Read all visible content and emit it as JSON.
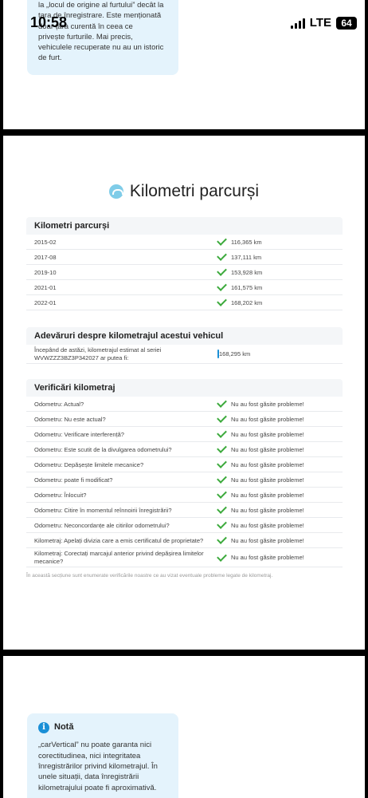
{
  "status_bar": {
    "time": "10:58",
    "network": "LTE",
    "battery": "64"
  },
  "top_info": {
    "lines": [
      "la „locul de origine al furtului” decât la",
      "țara de înregistrare. Este menționată",
      "doar țara curentă în ceea ce",
      "privește furturile. Mai precis,",
      "vehiculele recuperate nu au un istoric",
      "de furt."
    ]
  },
  "section": {
    "title": "Kilometri parcurși"
  },
  "mileage": {
    "heading": "Kilometri parcurși",
    "rows": [
      {
        "date": "2015-02",
        "km": "116,365 km"
      },
      {
        "date": "2017-08",
        "km": "137,111 km"
      },
      {
        "date": "2019-10",
        "km": "153,928 km"
      },
      {
        "date": "2021-01",
        "km": "161,575 km"
      },
      {
        "date": "2022-01",
        "km": "168,202 km"
      }
    ]
  },
  "truths": {
    "heading": "Adevăruri despre kilometrajul acestui vehicul",
    "text_line1": "Începând de astăzi, kilometrajul estimat al seriei",
    "text_line2": "WVWZZZ3BZ3P342027 ar putea fi:",
    "value": "168,295 km"
  },
  "checks": {
    "heading": "Verificări kilometraj",
    "result": "Nu au fost găsite probleme!",
    "rows": [
      "Odometru: Actual?",
      "Odometru: Nu este actual?",
      "Odometru: Verificare interferență?",
      "Odometru: Este scutit de la divulgarea odometrului?",
      "Odometru: Depășește limitele mecanice?",
      "Odometru: poate fi modificat?",
      "Odometru: Înlocuit?",
      "Odometru: Citire în momentul reînnoirii înregistrării?",
      "Odometru: Neconcordanțe ale citirilor odometrului?",
      "Kilometraj: Apelați divizia care a emis certificatul de proprietate?"
    ],
    "last_row_line1": "Kilometraj: Corectați marcajul anterior privind depășirea limitelor",
    "last_row_line2": "mecanice?"
  },
  "footnote": "În această secțiune sunt enumerate verificările noastre ce au vizat eventuale probleme legate de kilometraj.",
  "note": {
    "title": "Notă",
    "lines": [
      "„carVertical” nu poate garanta nici",
      "corectitudinea, nici integritatea",
      "înregistrărilor privind kilometrajul. În",
      "unele situații, data înregistrării",
      "kilometrajului poate fi aproximativă."
    ]
  }
}
